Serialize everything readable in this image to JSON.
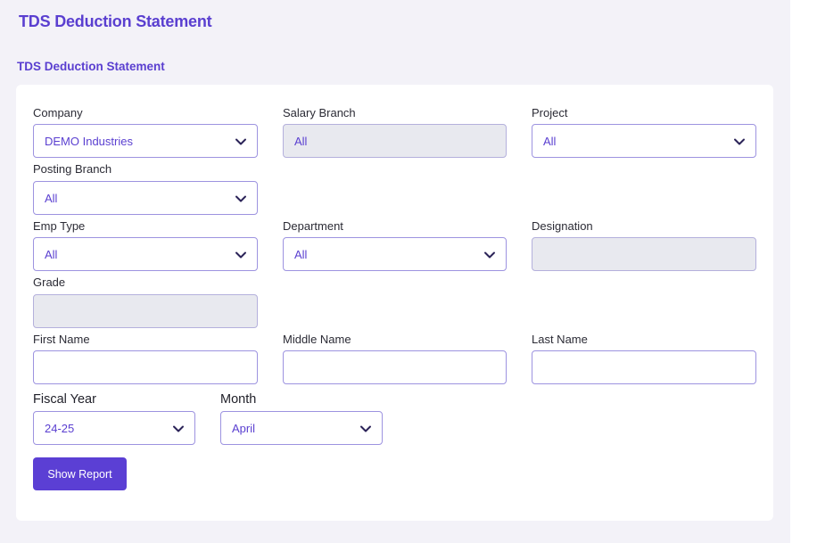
{
  "header": {
    "page_title": "TDS Deduction Statement",
    "section_title": "TDS Deduction Statement"
  },
  "form": {
    "company": {
      "label": "Company",
      "value": "DEMO Industries"
    },
    "salary_branch": {
      "label": "Salary Branch",
      "value": "All"
    },
    "project": {
      "label": "Project",
      "value": "All"
    },
    "posting_branch": {
      "label": "Posting Branch",
      "value": "All"
    },
    "emp_type": {
      "label": "Emp Type",
      "value": "All"
    },
    "department": {
      "label": "Department",
      "value": "All"
    },
    "designation": {
      "label": "Designation",
      "value": ""
    },
    "grade": {
      "label": "Grade",
      "value": ""
    },
    "first_name": {
      "label": "First Name",
      "value": ""
    },
    "middle_name": {
      "label": "Middle Name",
      "value": ""
    },
    "last_name": {
      "label": "Last Name",
      "value": ""
    },
    "fiscal_year": {
      "label": "Fiscal Year",
      "value": "24-25"
    },
    "month": {
      "label": "Month",
      "value": "April"
    },
    "show_report_label": "Show Report"
  },
  "colors": {
    "accent": "#5a3fd0",
    "button": "#5b3fd4",
    "border": "#9d93e0",
    "disabled_bg": "#e8e9ef",
    "page_bg": "#f3f2f8"
  },
  "icons": {
    "dropdown": "chevron-down-icon"
  }
}
